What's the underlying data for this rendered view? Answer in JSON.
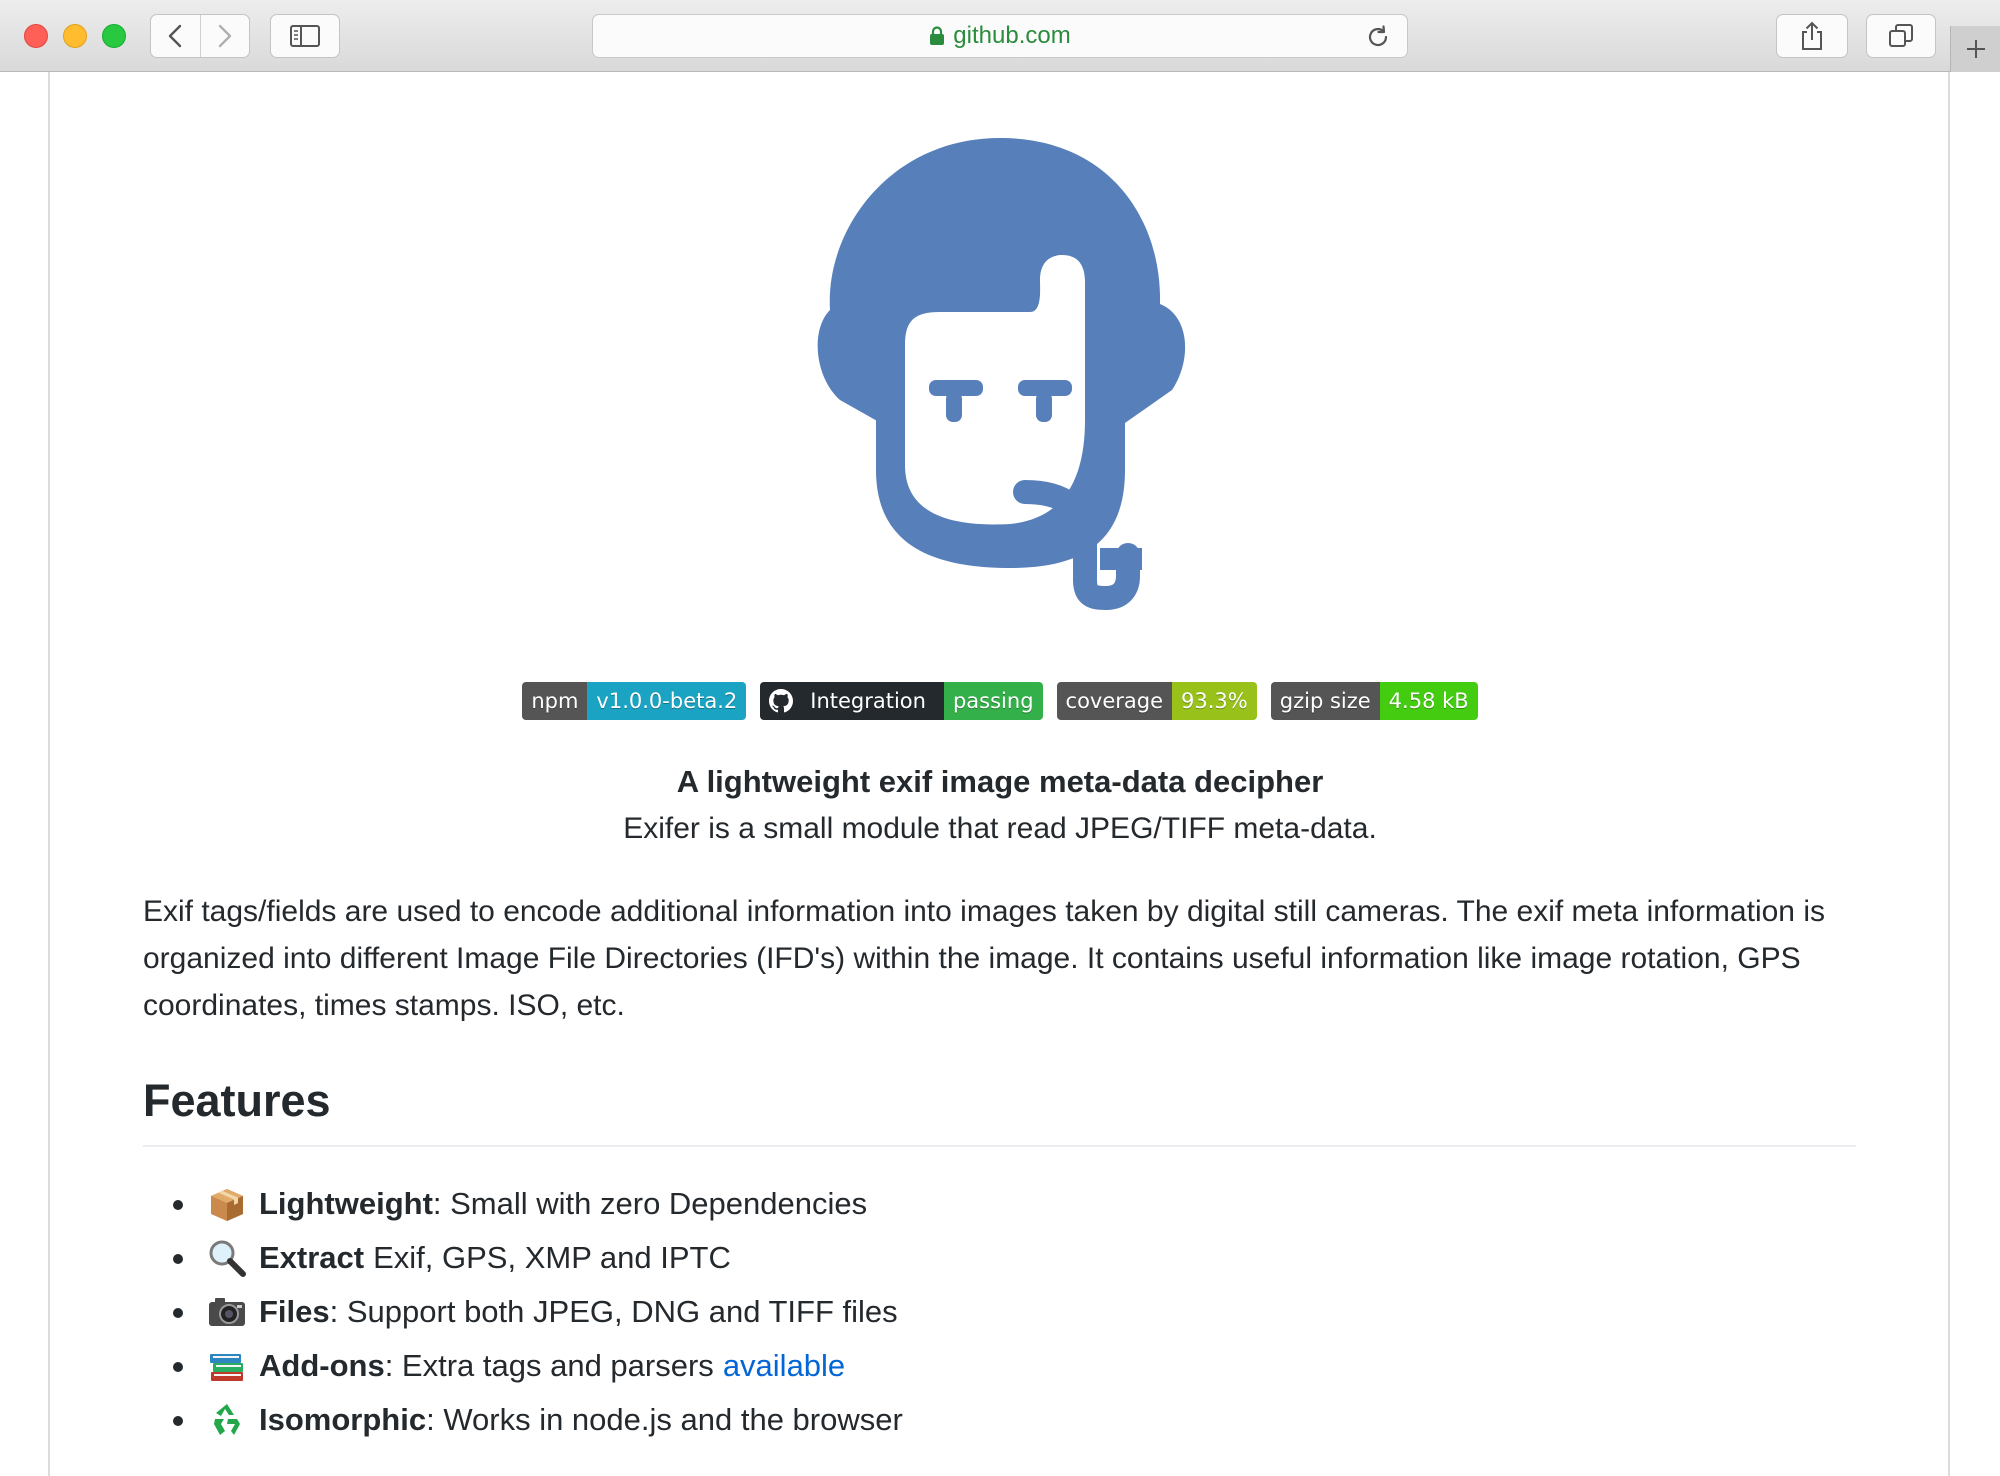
{
  "browser": {
    "url": "github.com",
    "colors": {
      "url_text": "#2a8c3c"
    }
  },
  "badges": [
    {
      "label": "npm",
      "value": "v1.0.0-beta.2",
      "color": "#1aa3c2"
    },
    {
      "label": "Integration",
      "value": "passing",
      "color": "#34b04a",
      "icon": "github-icon"
    },
    {
      "label": "coverage",
      "value": "93.3%",
      "color": "#98c21a"
    },
    {
      "label": "gzip size",
      "value": "4.58 kB",
      "color": "#44cc11"
    }
  ],
  "readme": {
    "tagline": "A lightweight exif image meta-data decipher",
    "subtitle": "Exifer is a small module that read JPEG/TIFF meta-data.",
    "description": "Exif tags/fields are used to encode additional information into images taken by digital still cameras. The exif meta information is organized into different Image File Directories (IFD's) within the image. It contains useful information like image rotation, GPS coordinates, times stamps. ISO, etc.",
    "features_heading": "Features",
    "features": [
      {
        "icon": "package-icon",
        "title": "Lightweight",
        "text": ": Small with zero Dependencies"
      },
      {
        "icon": "magnifier-icon",
        "title": "Extract",
        "text": "Exif, GPS, XMP and IPTC"
      },
      {
        "icon": "camera-icon",
        "title": "Files",
        "text": ": Support both JPEG, DNG and TIFF files"
      },
      {
        "icon": "books-icon",
        "title": "Add-ons",
        "text": ": Extra tags and parsers",
        "link": "available"
      },
      {
        "icon": "recycle-icon",
        "title": "Isomorphic",
        "text": ": Works in node.js and the browser"
      }
    ],
    "colors": {
      "logo": "#577fba",
      "link": "#0366d6"
    }
  }
}
